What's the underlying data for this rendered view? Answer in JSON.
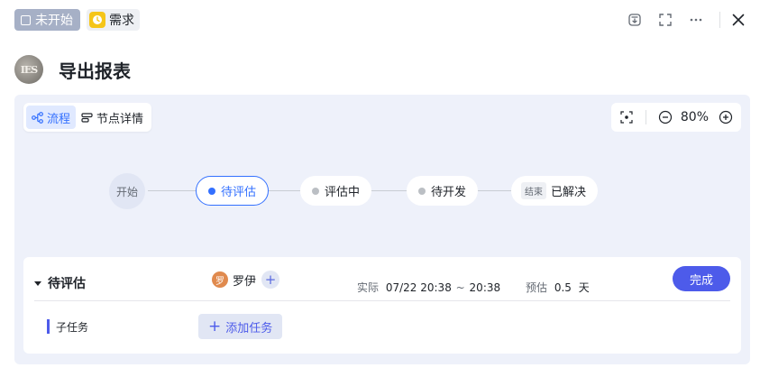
{
  "header": {
    "status_label": "未开始",
    "type_label": "需求",
    "icons": [
      "download-icon",
      "expand-icon",
      "more-icon",
      "close-icon"
    ]
  },
  "title": {
    "avatar_text": "IES",
    "text": "导出报表"
  },
  "view_switch": {
    "flow_label": "流程",
    "detail_label": "节点详情"
  },
  "zoom": {
    "value": "80%"
  },
  "flow": {
    "nodes": [
      {
        "label": "开始",
        "kind": "start"
      },
      {
        "label": "待评估",
        "kind": "current"
      },
      {
        "label": "评估中",
        "kind": "pending"
      },
      {
        "label": "待开发",
        "kind": "pending"
      },
      {
        "label": "已解决",
        "kind": "end",
        "badge": "结束"
      }
    ]
  },
  "card": {
    "state_name": "待评估",
    "assignee_avatar": "罗",
    "assignee_name": "罗伊",
    "actual_label": "实际",
    "actual_start": "07/22 20:38",
    "actual_sep": "~",
    "actual_end": "20:38",
    "estimate_label": "预估",
    "estimate_value": "0.5",
    "estimate_unit": "天",
    "done_label": "完成",
    "subtask_label": "子任务",
    "add_subtask_label": "添加任务"
  },
  "colors": {
    "accent": "#4d5bea",
    "status_tag": "#a6b0c6",
    "type_icon": "#f5c518",
    "panel_bg": "#eef1fa"
  }
}
